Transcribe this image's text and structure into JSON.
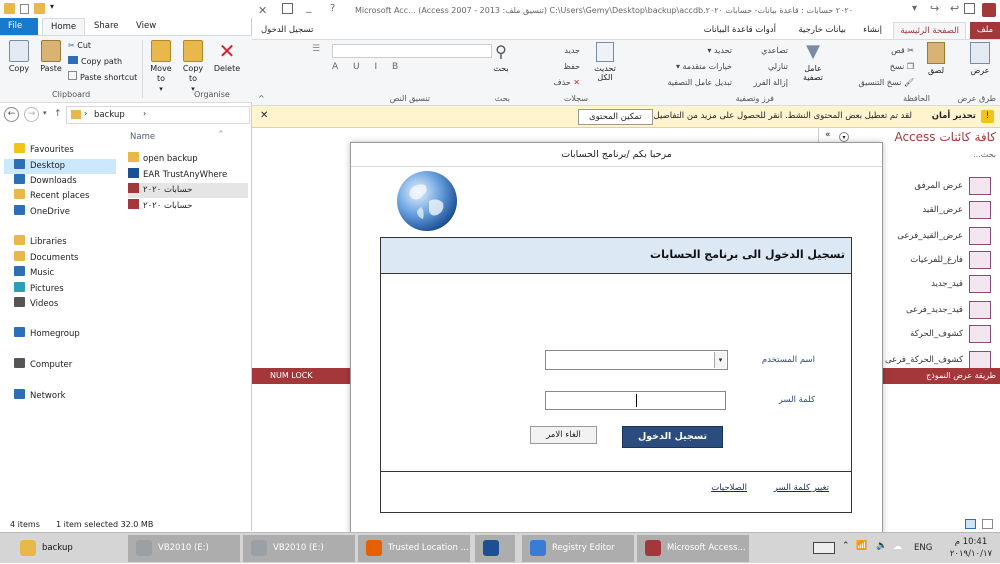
{
  "explorer": {
    "tabs": [
      "File",
      "Home",
      "Share",
      "View"
    ],
    "ribbon": {
      "copy": "Copy",
      "paste": "Paste",
      "cut": "Cut",
      "copy_path": "Copy path",
      "paste_shortcut": "Paste shortcut",
      "move_to": "Move to",
      "copy_to": "Copy to",
      "delete": "Delete",
      "clipboard_group": "Clipboard",
      "organise_group": "Organise"
    },
    "address": "backup",
    "nav": [
      {
        "label": "Favourites",
        "icon": "star-icon"
      },
      {
        "label": "Desktop",
        "icon": "desktop-icon"
      },
      {
        "label": "Downloads",
        "icon": "downloads-icon"
      },
      {
        "label": "Recent places",
        "icon": "recent-places-icon"
      },
      {
        "label": "OneDrive",
        "icon": "onedrive-icon"
      },
      {
        "label": "Libraries",
        "icon": "libraries-icon"
      },
      {
        "label": "Documents",
        "icon": "documents-icon"
      },
      {
        "label": "Music",
        "icon": "music-icon"
      },
      {
        "label": "Pictures",
        "icon": "pictures-icon"
      },
      {
        "label": "Videos",
        "icon": "videos-icon"
      },
      {
        "label": "Homegroup",
        "icon": "homegroup-icon"
      },
      {
        "label": "Computer",
        "icon": "computer-icon"
      },
      {
        "label": "Network",
        "icon": "network-icon"
      }
    ],
    "column_name": "Name",
    "files": [
      {
        "name": "open backup",
        "icon": "folder-icon"
      },
      {
        "name": "EAR TrustAnyWhere",
        "icon": "app-icon"
      },
      {
        "name": "حسابات ٢٠٢٠",
        "icon": "access-db-icon"
      },
      {
        "name": "حسابات ٢٠٢٠",
        "icon": "access-db-icon"
      }
    ],
    "status_items": "4 items",
    "status_selected": "1 item selected  32.0 MB"
  },
  "access": {
    "title": "Microsoft Acc... (Access 2007 - 2013 :تنسيق ملف) C:\\Users\\Gemy\\Desktop\\backup\\accdb.٢٠٢٠ حسابات : قاعدة بيانات- حسابات ٢٠٢٠",
    "login_tab": "تسجيل الدخول",
    "tabs": [
      "ملف",
      "الصفحة الرئيسية",
      "إنشاء",
      "بيانات خارجية",
      "أدوات قاعدة البيانات"
    ],
    "groups": [
      "طرق عرض",
      "الحافظة",
      "فرز وتصفية",
      "سجلات",
      "بحث",
      "تنسيق النص"
    ],
    "ribbon": {
      "view": "عرض",
      "paste": "لصق",
      "cut": "قص",
      "copy": "نسخ",
      "format_painter": "نسخ التنسيق",
      "filter": "عامل تصفية",
      "ascending": "تصاعدي",
      "descending": "تنازلي",
      "remove_sort": "إزالة الفرز",
      "selection": "تحديد",
      "advanced": "خيارات متقدمة",
      "toggle_filter": "تبديل عامل التصفية",
      "refresh_all": "تحديث الكل",
      "new": "جديد",
      "save": "حفظ",
      "delete": "حذف",
      "find": "بحث"
    },
    "security_title": "تحذير أمان",
    "security_msg": "لقد تم تعطيل بعض المحتوى النشط. انقر للحصول على مزيد من التفاصيل.",
    "enable_content": "تمكين المحتوى",
    "status_left": "NUM LOCK",
    "status_right": "طريقة عرض النموذج"
  },
  "navpane": {
    "title": "كافة كائنات Access",
    "search": "بحث...",
    "items": [
      "عرض المرفق",
      "عرض_القيد",
      "عرض_القيد_فرعى",
      "فارغ_للفرعيات",
      "قيد_جديد",
      "قيد_جديد_فرعى",
      "كشوف_الحركة",
      "كشوف_الحركة_فرعى"
    ]
  },
  "dialog": {
    "title": "مرحبا بكم /برنامج الحسابات",
    "form_title": "تسجيل الدخول الى برنامج الحسابات",
    "username_label": "اسم المستخدم",
    "password_label": "كلمة السر",
    "login_button": "تسجيل الدخول",
    "cancel_button": "الغاء الامر",
    "change_password": "تغيير كلمة السر",
    "permissions": "الصلاحيات"
  },
  "taskbar": {
    "items": [
      {
        "label": "backup",
        "icon": "folder-icon"
      },
      {
        "label": "VB2010 (E:)",
        "icon": "drive-icon"
      },
      {
        "label": "VB2010 (E:)",
        "icon": "drive-icon"
      },
      {
        "label": "Trusted Location ...",
        "icon": "firefox-icon"
      },
      {
        "label": "",
        "icon": "app-icon"
      },
      {
        "label": "Registry Editor",
        "icon": "registry-icon"
      },
      {
        "label": "Microsoft Access...",
        "icon": "access-icon"
      }
    ],
    "language": "ENG",
    "time": "10:41 م",
    "date": "٢٠١٩/١٠/١٧"
  },
  "colors": {
    "access_accent": "#a4373a",
    "explorer_file_tab": "#1979ca",
    "security_bar": "#fff4ce",
    "login_button": "#2b4c7e",
    "form_header": "#dde8f5"
  }
}
